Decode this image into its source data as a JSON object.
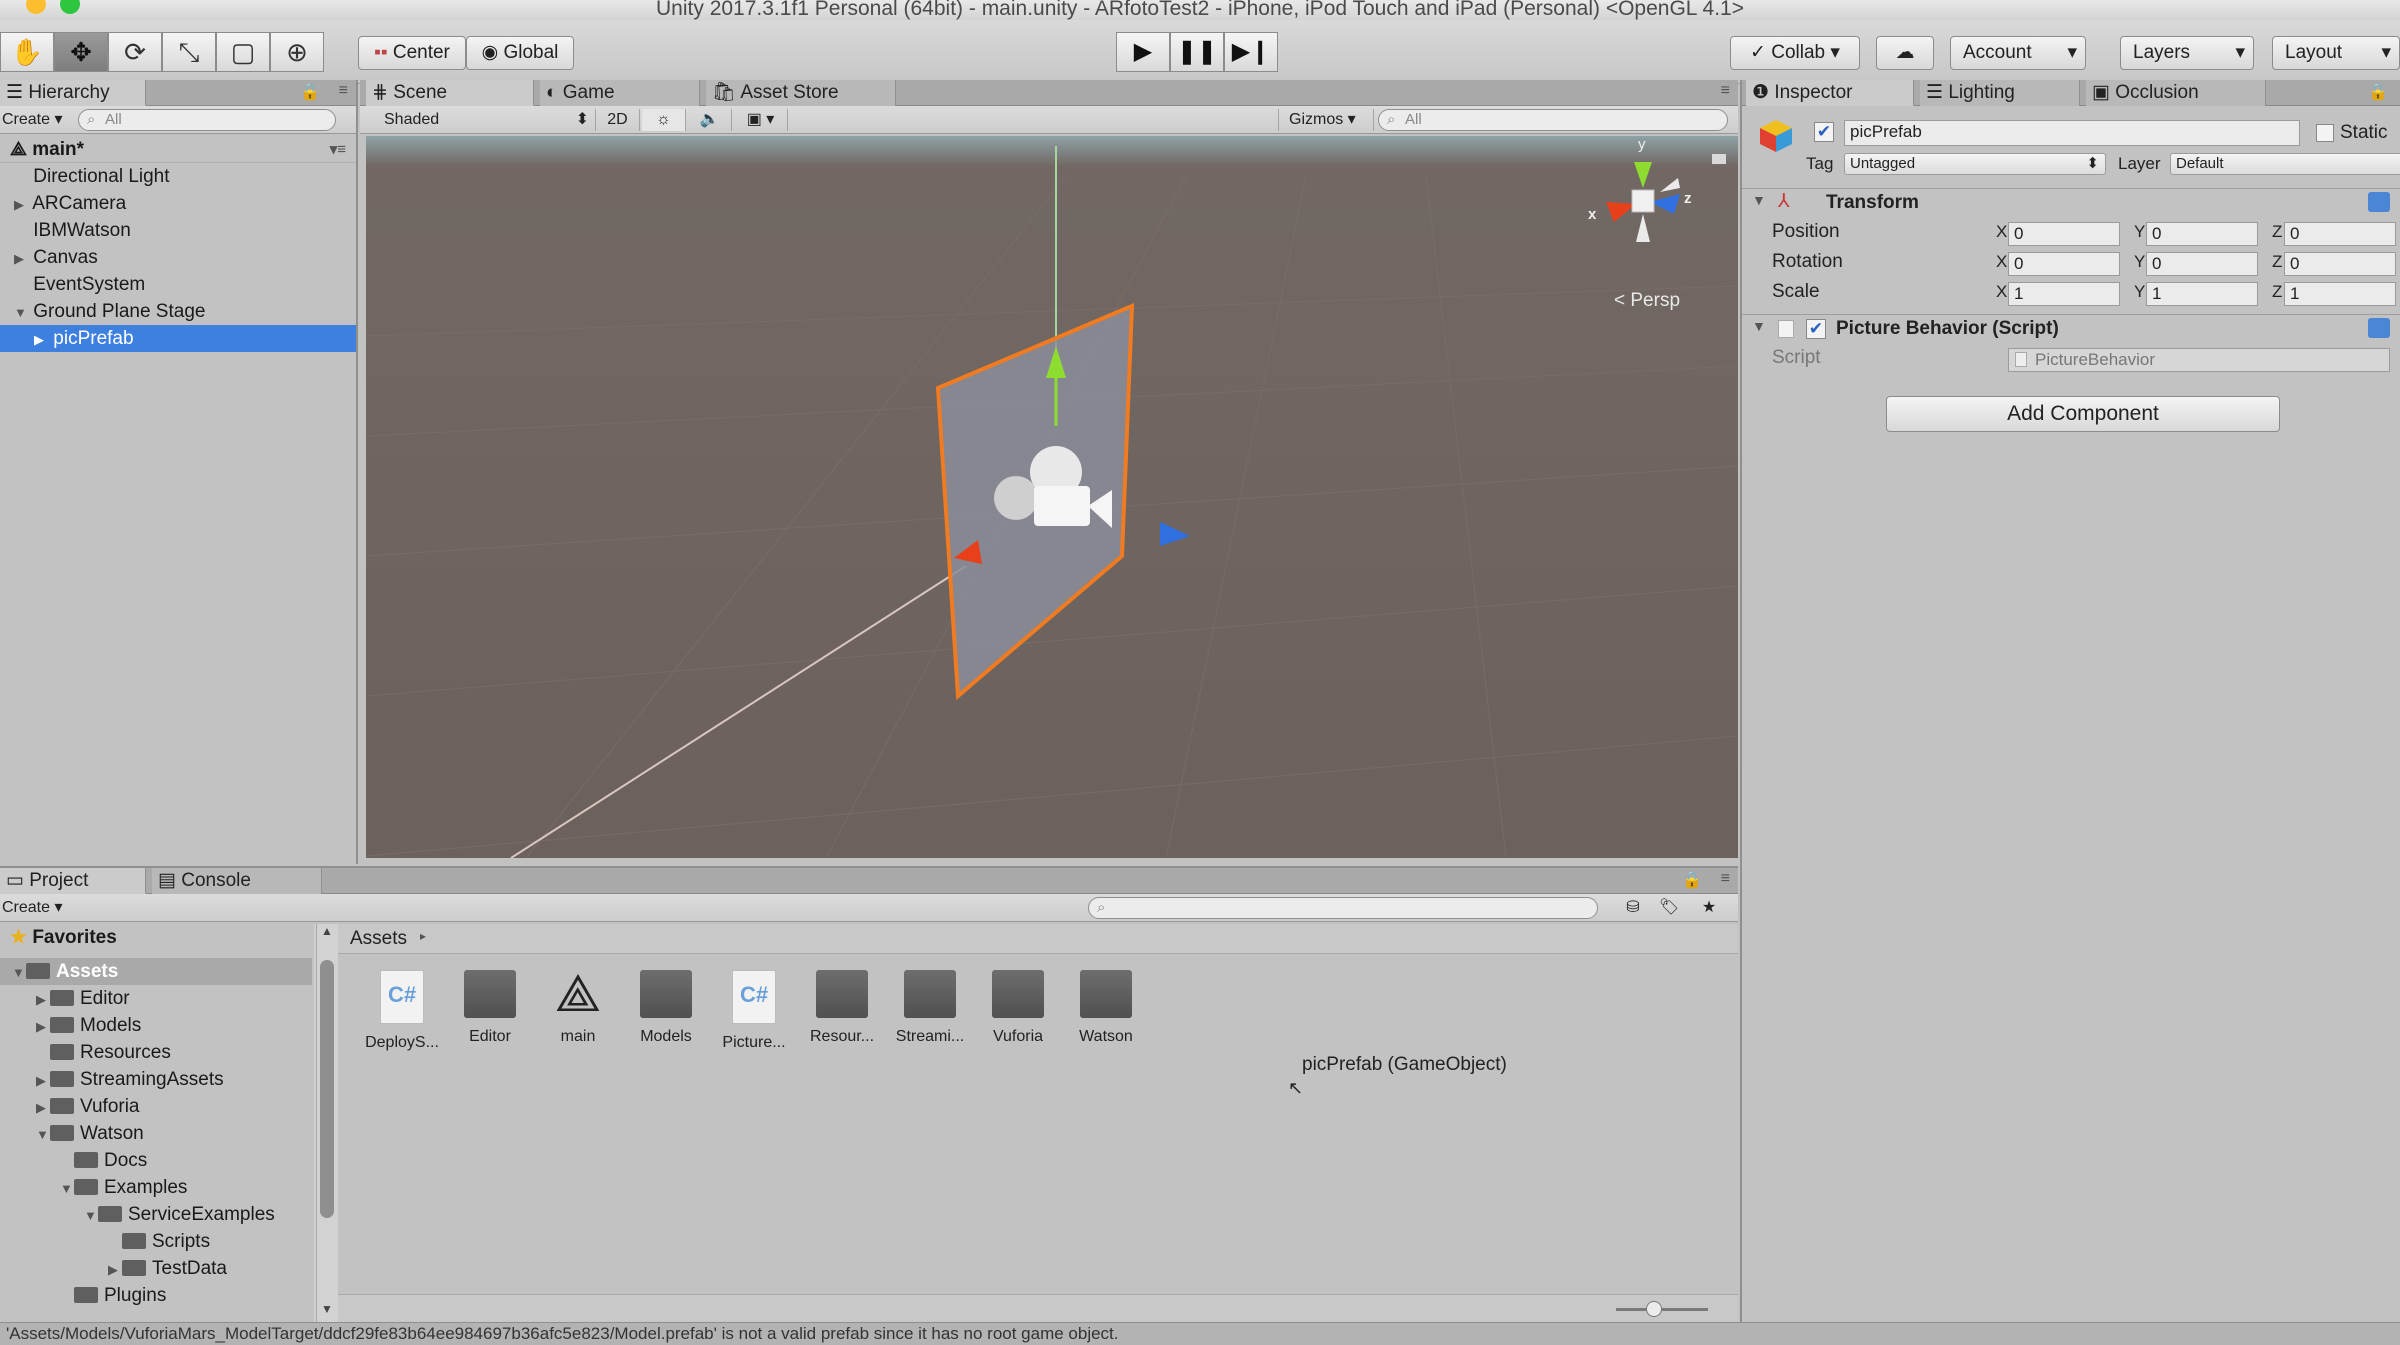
{
  "window": {
    "title": "Unity 2017.3.1f1 Personal (64bit) - main.unity - ARfotoTest2 - iPhone, iPod Touch and iPad (Personal) <OpenGL 4.1>"
  },
  "toolbar": {
    "tools": [
      "hand-icon",
      "move-icon",
      "rotate-icon",
      "scale-icon",
      "rect-icon",
      "transform-icon"
    ],
    "pivot_label": "Center",
    "space_label": "Global",
    "collab_label": "Collab",
    "account_label": "Account",
    "layers_label": "Layers",
    "layout_label": "Layout"
  },
  "hierarchy": {
    "tab": "Hierarchy",
    "create": "Create",
    "search_placeholder": "All",
    "scene_name": "main*",
    "items": [
      {
        "label": "Directional Light",
        "indent": 0,
        "arrow": ""
      },
      {
        "label": "ARCamera",
        "indent": 0,
        "arrow": "▶"
      },
      {
        "label": "IBMWatson",
        "indent": 0,
        "arrow": ""
      },
      {
        "label": "Canvas",
        "indent": 0,
        "arrow": "▶"
      },
      {
        "label": "EventSystem",
        "indent": 0,
        "arrow": ""
      },
      {
        "label": "Ground Plane Stage",
        "indent": 0,
        "arrow": "▼"
      },
      {
        "label": "picPrefab",
        "indent": 1,
        "arrow": "▶",
        "selected": true
      }
    ]
  },
  "scene": {
    "tabs": [
      "Scene",
      "Game",
      "Asset Store"
    ],
    "shading": "Shaded",
    "mode_2d": "2D",
    "gizmos": "Gizmos",
    "search_placeholder": "All",
    "persp_label": "Persp",
    "axis_x": "x",
    "axis_y": "y",
    "axis_z": "z"
  },
  "inspector": {
    "tabs": [
      "Inspector",
      "Lighting",
      "Occlusion"
    ],
    "object_name": "picPrefab",
    "static_label": "Static",
    "tag_label": "Tag",
    "tag_value": "Untagged",
    "layer_label": "Layer",
    "layer_value": "Default",
    "transform": {
      "title": "Transform",
      "position": {
        "label": "Position",
        "x": "0",
        "y": "0",
        "z": "0"
      },
      "rotation": {
        "label": "Rotation",
        "x": "0",
        "y": "0",
        "z": "0"
      },
      "scale": {
        "label": "Scale",
        "x": "1",
        "y": "1",
        "z": "1"
      }
    },
    "script_component": {
      "title": "Picture Behavior (Script)",
      "script_label": "Script",
      "script_value": "PictureBehavior"
    },
    "add_component": "Add Component"
  },
  "project": {
    "tabs": [
      "Project",
      "Console"
    ],
    "create": "Create",
    "favorites": "Favorites",
    "tree": [
      {
        "label": "Assets",
        "indent": 0,
        "arrow": "▼",
        "header": true
      },
      {
        "label": "Editor",
        "indent": 1,
        "arrow": "▶"
      },
      {
        "label": "Models",
        "indent": 1,
        "arrow": "▶"
      },
      {
        "label": "Resources",
        "indent": 1,
        "arrow": ""
      },
      {
        "label": "StreamingAssets",
        "indent": 1,
        "arrow": "▶"
      },
      {
        "label": "Vuforia",
        "indent": 1,
        "arrow": "▶"
      },
      {
        "label": "Watson",
        "indent": 1,
        "arrow": "▼"
      },
      {
        "label": "Docs",
        "indent": 2,
        "arrow": ""
      },
      {
        "label": "Examples",
        "indent": 2,
        "arrow": "▼"
      },
      {
        "label": "ServiceExamples",
        "indent": 3,
        "arrow": "▼"
      },
      {
        "label": "Scripts",
        "indent": 4,
        "arrow": ""
      },
      {
        "label": "TestData",
        "indent": 4,
        "arrow": "▶"
      },
      {
        "label": "Plugins",
        "indent": 2,
        "arrow": ""
      }
    ],
    "breadcrumb": "Assets",
    "assets": [
      {
        "label": "DeployS...",
        "type": "script"
      },
      {
        "label": "Editor",
        "type": "folder"
      },
      {
        "label": "main",
        "type": "unity"
      },
      {
        "label": "Models",
        "type": "folder"
      },
      {
        "label": "Picture...",
        "type": "script"
      },
      {
        "label": "Resour...",
        "type": "folder"
      },
      {
        "label": "Streami...",
        "type": "folder"
      },
      {
        "label": "Vuforia",
        "type": "folder"
      },
      {
        "label": "Watson",
        "type": "folder"
      }
    ],
    "drag_tooltip": "picPrefab (GameObject)"
  },
  "status": {
    "message": "'Assets/Models/VuforiaMars_ModelTarget/ddcf29fe83b64ee984697b36afc5e823/Model.prefab' is not a valid prefab since it has no root game object."
  }
}
